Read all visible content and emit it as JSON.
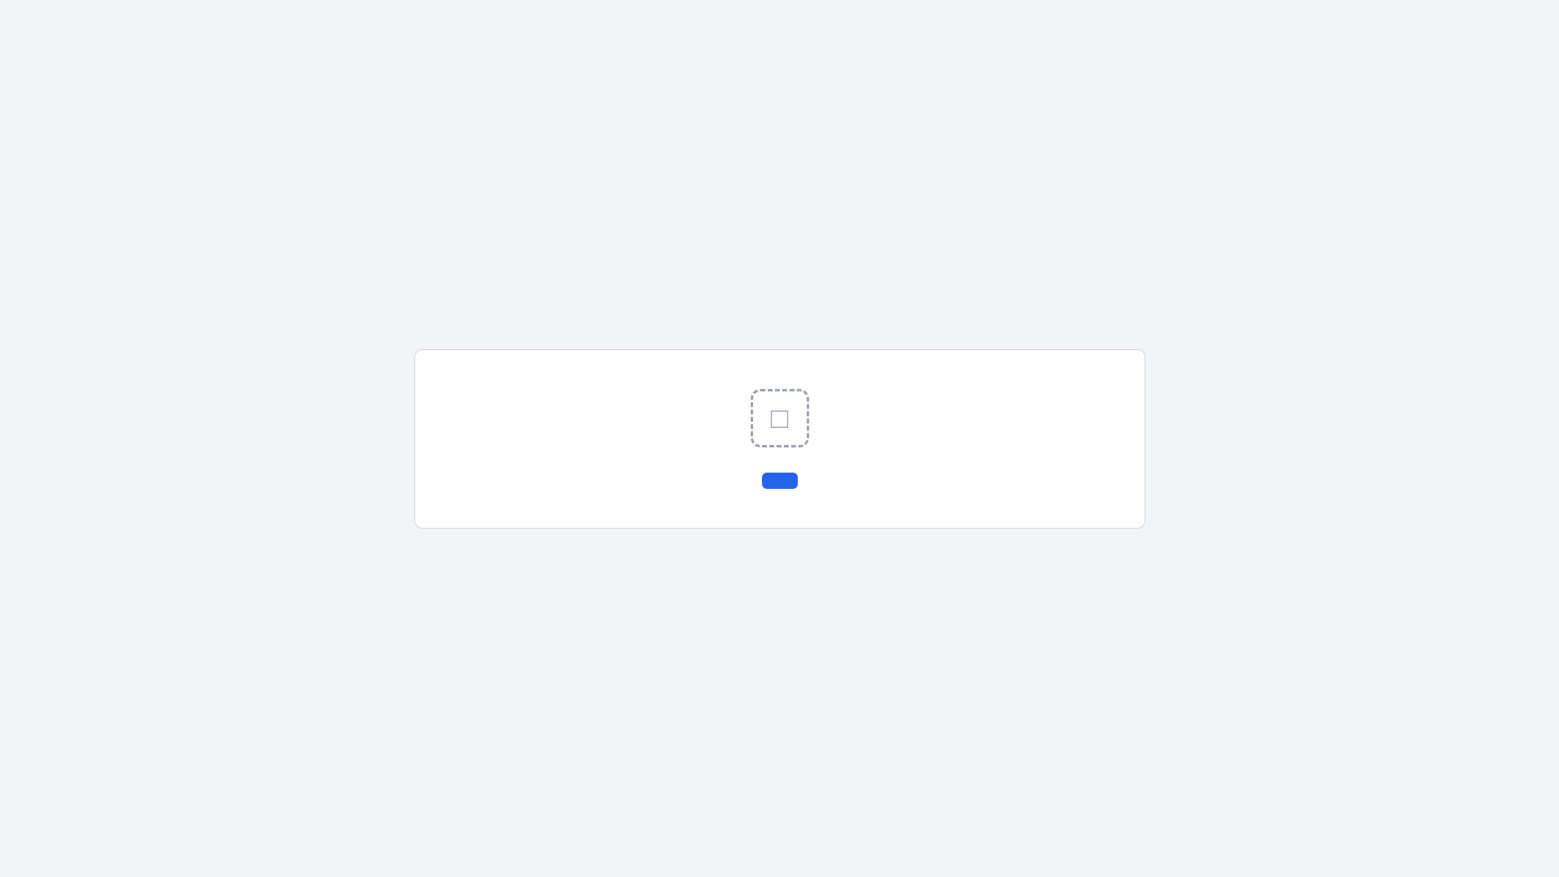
{
  "notice": {
    "title": "",
    "message": "",
    "action_label": ""
  }
}
